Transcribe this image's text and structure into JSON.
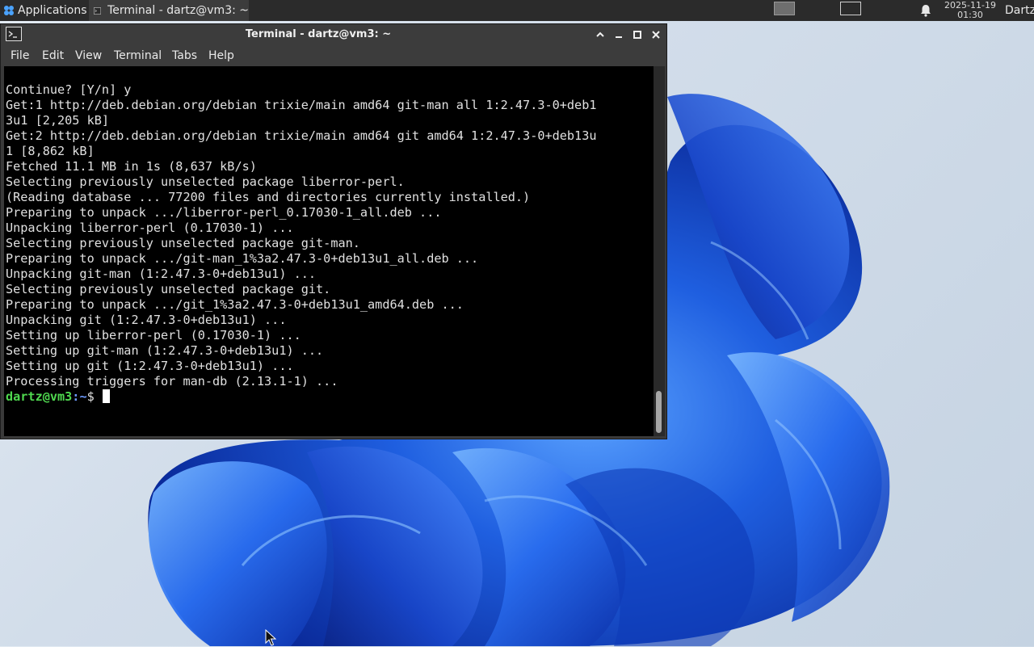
{
  "panel": {
    "applications_label": "Applications",
    "task_title": "Terminal - dartz@vm3: ~",
    "clock_date": "2025-11-19",
    "clock_time": "01:30",
    "user_label": "Dartz"
  },
  "window": {
    "title": "Terminal - dartz@vm3: ~",
    "menu": [
      "File",
      "Edit",
      "View",
      "Terminal",
      "Tabs",
      "Help"
    ]
  },
  "terminal": {
    "lines": [
      "Continue? [Y/n] y",
      "Get:1 http://deb.debian.org/debian trixie/main amd64 git-man all 1:2.47.3-0+deb1",
      "3u1 [2,205 kB]",
      "Get:2 http://deb.debian.org/debian trixie/main amd64 git amd64 1:2.47.3-0+deb13u",
      "1 [8,862 kB]",
      "Fetched 11.1 MB in 1s (8,637 kB/s)",
      "Selecting previously unselected package liberror-perl.",
      "(Reading database ... 77200 files and directories currently installed.)",
      "Preparing to unpack .../liberror-perl_0.17030-1_all.deb ...",
      "Unpacking liberror-perl (0.17030-1) ...",
      "Selecting previously unselected package git-man.",
      "Preparing to unpack .../git-man_1%3a2.47.3-0+deb13u1_all.deb ...",
      "Unpacking git-man (1:2.47.3-0+deb13u1) ...",
      "Selecting previously unselected package git.",
      "Preparing to unpack .../git_1%3a2.47.3-0+deb13u1_amd64.deb ...",
      "Unpacking git (1:2.47.3-0+deb13u1) ...",
      "Setting up liberror-perl (0.17030-1) ...",
      "Setting up git-man (1:2.47.3-0+deb13u1) ...",
      "Setting up git (1:2.47.3-0+deb13u1) ...",
      "Processing triggers for man-db (2.13.1-1) ..."
    ],
    "prompt_user": "dartz@vm3",
    "prompt_path": ":~",
    "prompt_symbol": "$ "
  },
  "colors": {
    "prompt_user": "#4fd84f",
    "prompt_path": "#6e9bff",
    "wallpaper_accent": "#1f5fe0"
  }
}
